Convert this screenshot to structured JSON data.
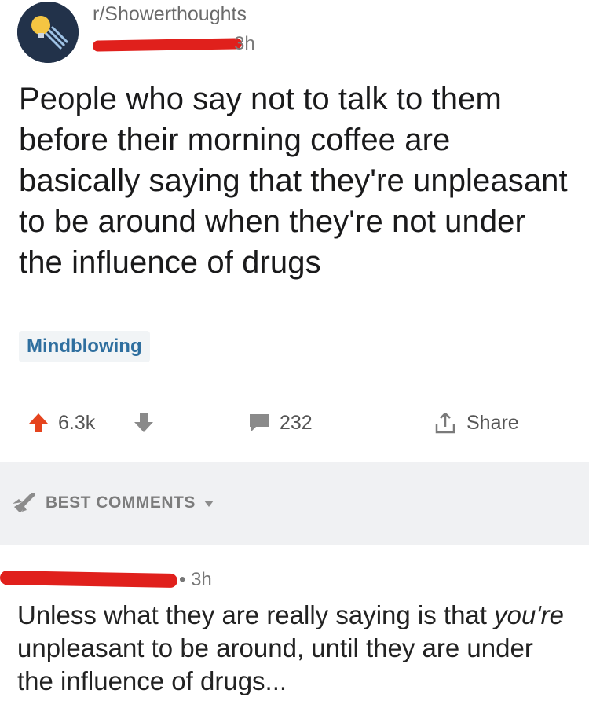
{
  "post": {
    "subreddit": "r/Showerthoughts",
    "age": "3h",
    "title": "People who say not to talk to them before their morning coffee are basically saying that they're unpleasant to be around when they're not under the influence of drugs",
    "flair": "Mindblowing",
    "upvotes": "6.3k",
    "comment_count": "232",
    "share_label": "Share"
  },
  "comments_section": {
    "sort_label": "BEST COMMENTS"
  },
  "top_comment": {
    "age": "3h",
    "text_part1": "Unless what they are really saying is that",
    "text_emphasis": "you're",
    "text_part2": "unpleasant to be around, until they are under the influence of drugs..."
  },
  "colors": {
    "upvote_active": "#e5441e",
    "flair_text": "#2f6f9f",
    "redaction": "#e0201c"
  },
  "icons": [
    "shower-head-icon",
    "arrow-up-icon",
    "arrow-down-icon",
    "comment-icon",
    "share-icon",
    "rocket-icon",
    "caret-down-icon"
  ]
}
